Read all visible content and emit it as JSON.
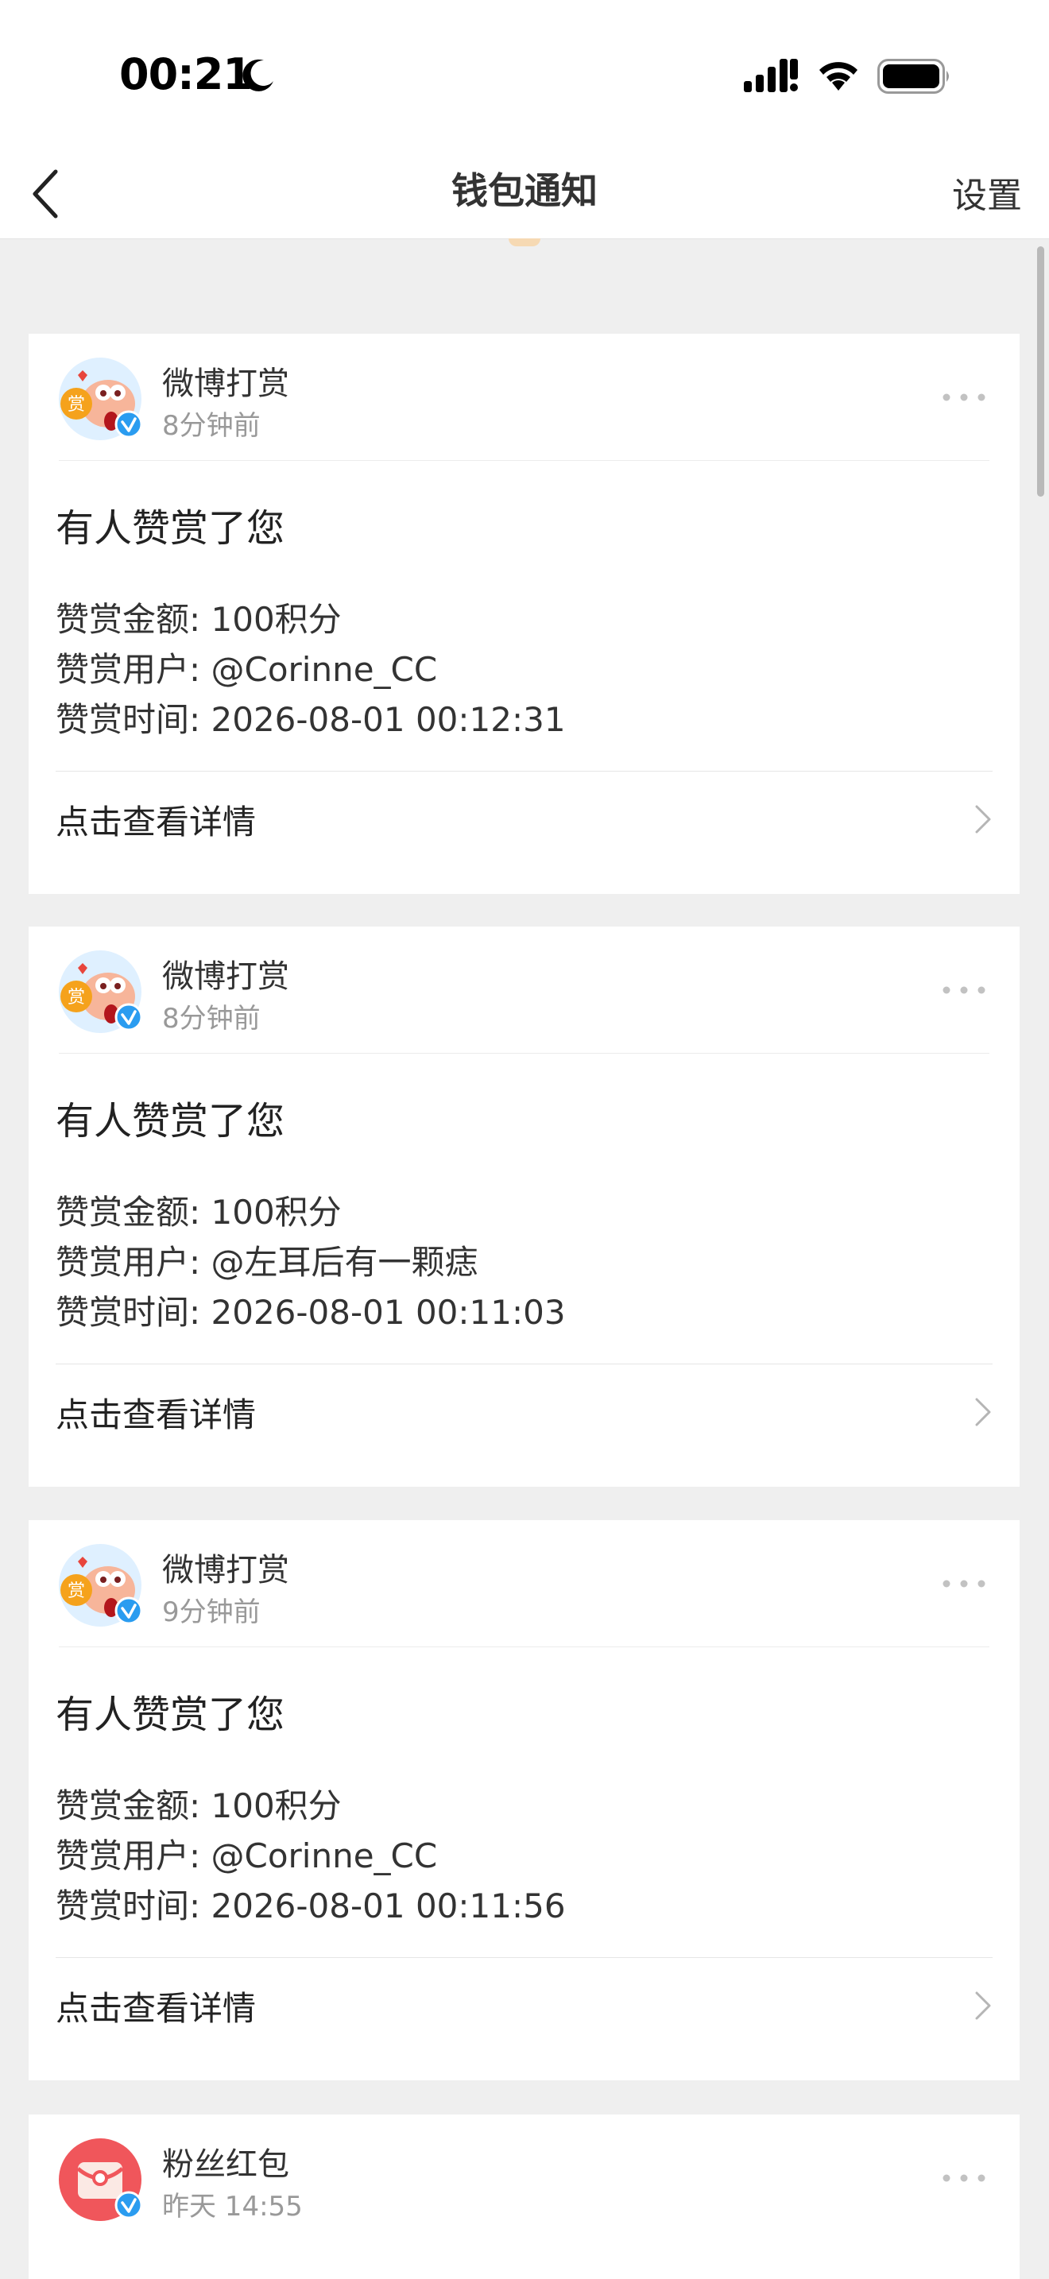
{
  "status_bar": {
    "time": "00:21",
    "icons": [
      "moon-icon",
      "cellular-signal-icon",
      "wifi-icon",
      "battery-icon"
    ]
  },
  "nav": {
    "title": "钱包通知",
    "settings_label": "设置",
    "back_icon": "chevron-left-icon"
  },
  "labels": {
    "amount_label": "赞赏金额: ",
    "user_label": "赞赏用户: ",
    "time_label": "赞赏时间: ",
    "view_details": "点击查看详情"
  },
  "notifications": [
    {
      "sender": "微博打赏",
      "time": "8分钟前",
      "title": "有人赞赏了您",
      "amount": "100积分",
      "user": "@Corinne_CC",
      "reward_time": "2026-08-01 00:12:31"
    },
    {
      "sender": "微博打赏",
      "time": "8分钟前",
      "title": "有人赞赏了您",
      "amount": "100积分",
      "user": "@左耳后有一颗痣",
      "reward_time": "2026-08-01 00:11:03"
    },
    {
      "sender": "微博打赏",
      "time": "9分钟前",
      "title": "有人赞赏了您",
      "amount": "100积分",
      "user": "@Corinne_CC",
      "reward_time": "2026-08-01 00:11:56"
    },
    {
      "sender": "粉丝红包",
      "time": "昨天 14:55"
    }
  ],
  "colors": {
    "background": "#efefef",
    "verified_blue": "#2a9cf0",
    "red_packet": "#f0565b",
    "avatar_bg": "#ffd9a6"
  }
}
